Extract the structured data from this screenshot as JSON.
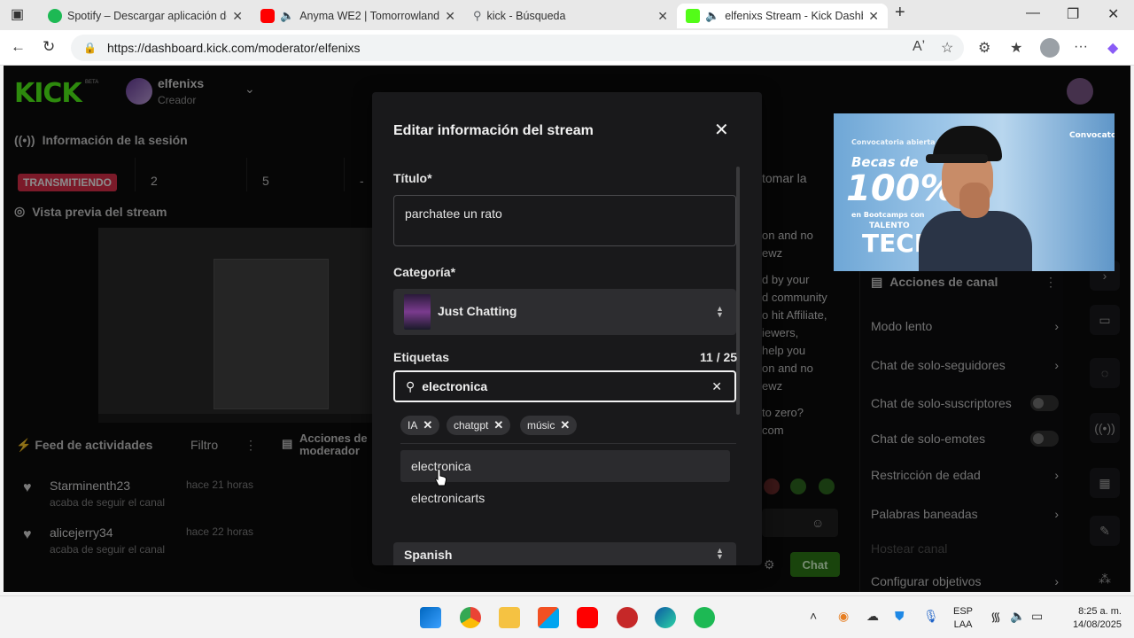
{
  "browser": {
    "tabs": [
      {
        "title": "Spotify – Descargar aplicación de",
        "icon": "spotify-icon",
        "color": "#1db954"
      },
      {
        "title": "Anyma WE2 | Tomorrowland",
        "icon": "youtube-icon",
        "color": "#ff0000"
      },
      {
        "title": "kick - Búsqueda",
        "icon": "search-icon",
        "color": "#8ab4f8"
      },
      {
        "title": "elfenixs Stream - Kick Dashbo",
        "icon": "kick-icon",
        "color": "#53fc18"
      }
    ],
    "url": "https://dashboard.kick.com/moderator/elfenixs"
  },
  "header": {
    "logo": "KICK",
    "beta": "BETA",
    "channel_name": "elfenixs",
    "channel_role": "Creador"
  },
  "session": {
    "title": "Información de la sesión",
    "status": "TRANSMITIENDO",
    "stats": [
      "2",
      "5",
      "-"
    ]
  },
  "preview": {
    "title": "Vista previa del stream"
  },
  "feed": {
    "title": "Feed de actividades",
    "filter": "Filtro",
    "items": [
      {
        "user": "Starminenth23",
        "when": "hace 21 horas",
        "desc": "acaba de seguir el canal"
      },
      {
        "user": "alicejerry34",
        "when": "hace 22 horas",
        "desc": "acaba de seguir el canal"
      }
    ]
  },
  "mod_actions": {
    "title": "Acciones de moderador"
  },
  "chat": {
    "fragments": [
      "tomar la",
      "on and no",
      "ewz",
      "d by your",
      "d community",
      "o hit Affiliate,",
      "iewers,",
      "help you",
      "on and no",
      "ewz",
      "to zero?",
      "com"
    ],
    "send": "Chat"
  },
  "channel_actions": {
    "title": "Acciones de canal",
    "items": [
      {
        "label": "Modo lento",
        "kind": "chevron"
      },
      {
        "label": "Chat de solo-seguidores",
        "kind": "chevron"
      },
      {
        "label": "Chat de solo-suscriptores",
        "kind": "toggle"
      },
      {
        "label": "Chat de solo-emotes",
        "kind": "toggle"
      },
      {
        "label": "Restricción de edad",
        "kind": "chevron"
      },
      {
        "label": "Palabras baneadas",
        "kind": "chevron"
      },
      {
        "label": "Hostear canal",
        "kind": "muted"
      },
      {
        "label": "Configurar objetivos",
        "kind": "chevron"
      }
    ]
  },
  "modal": {
    "title": "Editar información del stream",
    "title_label": "Título*",
    "title_value": "parchatee un rato",
    "category_label": "Categoría*",
    "category_value": "Just Chatting",
    "tags_label": "Etiquetas",
    "tags_count": "11 / 25",
    "tag_search_value": "electronica",
    "tags": [
      "IA",
      "chatgpt",
      "músic"
    ],
    "suggestions": [
      "electronica",
      "electronicarts"
    ],
    "language_value": "Spanish"
  },
  "webcam": {
    "banner_left": "Convocatoria abierta",
    "banner_right": "Convocato",
    "becas": "Becas de",
    "pct": "100%",
    "bootcamps": "en Bootcamps con",
    "talento": "TALENTO",
    "tech": "TECH"
  },
  "taskbar": {
    "lang_top": "ESP",
    "lang_bottom": "LAA",
    "time": "8:25 a. m.",
    "date": "14/08/2025"
  }
}
